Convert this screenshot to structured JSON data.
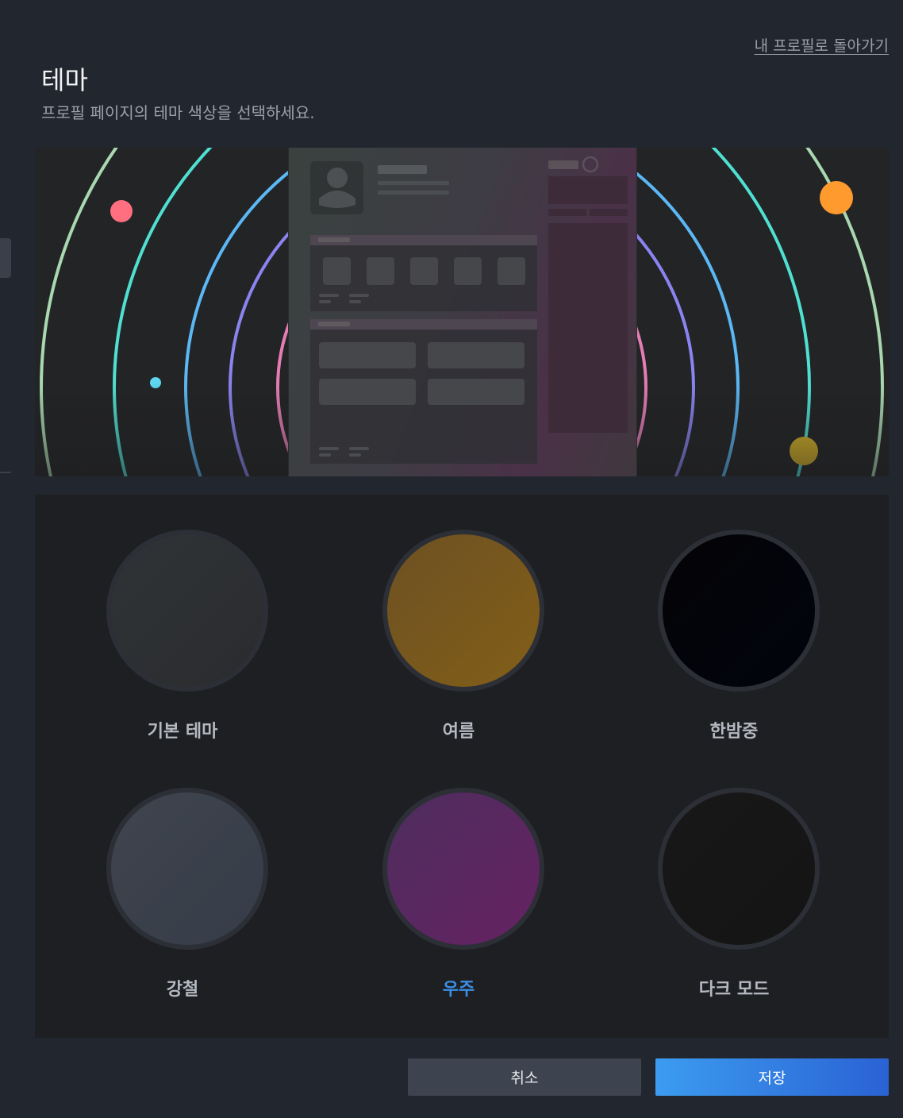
{
  "header": {
    "back_link": "내 프로필로 돌아가기",
    "title": "테마",
    "subtitle": "프로필 페이지의 테마 색상을 선택하세요."
  },
  "preview": {
    "ring_colors": [
      "#e57db4",
      "#8a84f0",
      "#5bb8f5",
      "#4fe0d2",
      "#a9d8b0"
    ],
    "planet_colors": [
      "#ff6f80",
      "#5fd6f0",
      "#ff9a2e",
      "#d8b428"
    ]
  },
  "themes": [
    {
      "label": "기본 테마",
      "color_start": "#2f3437",
      "color_end": "#2b2b2e",
      "selected": false
    },
    {
      "label": "여름",
      "color_start": "#6d5123",
      "color_end": "#825e17",
      "selected": false
    },
    {
      "label": "한밤중",
      "color_start": "#040406",
      "color_end": "#02040e",
      "selected": false
    },
    {
      "label": "강철",
      "color_start": "#40444e",
      "color_end": "#353d48",
      "selected": false
    },
    {
      "label": "우주",
      "color_start": "#4e2d5e",
      "color_end": "#652262",
      "selected": true
    },
    {
      "label": "다크 모드",
      "color_start": "#181818",
      "color_end": "#141414",
      "selected": false
    }
  ],
  "footer": {
    "cancel_label": "취소",
    "save_label": "저장"
  }
}
